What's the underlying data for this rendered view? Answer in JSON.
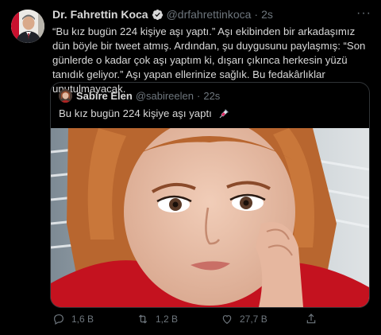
{
  "tweet": {
    "author_name": "Dr. Fahrettin Koca",
    "author_handle": "@drfahrettinkoca",
    "separator": "·",
    "time": "2s",
    "more_label": "···",
    "text": "“Bu kız bugün 224 kişiye aşı yaptı.” Aşı ekibinden bir arkadaşımız dün böyle bir tweet atmış. Ardından, şu duygusunu paylaşmış: “Son günlerde o kadar çok aşı yaptım ki, dışarı çıkınca herkesin yüzü tanıdık geliyor.” Aşı yapan ellerinize sağlık. Bu fedakârlıklar unutulmayacak."
  },
  "quote": {
    "author_name": "Sabire Elen",
    "author_handle": "@sabireelen",
    "separator": "·",
    "time": "22s",
    "text": "Bu kız bugün 224 kişiye aşı yaptı"
  },
  "actions": {
    "reply_count": "1,6 B",
    "retweet_count": "1,2 B",
    "like_count": "27,7 B"
  },
  "colors": {
    "background": "#000000",
    "text": "#d9d9d9",
    "muted": "#6e767d",
    "verified": "#1da1f2",
    "border": "#2f3336"
  },
  "icons": [
    "verified-badge-icon",
    "more-icon",
    "syringe-icon",
    "reply-icon",
    "retweet-icon",
    "like-icon",
    "share-icon"
  ]
}
